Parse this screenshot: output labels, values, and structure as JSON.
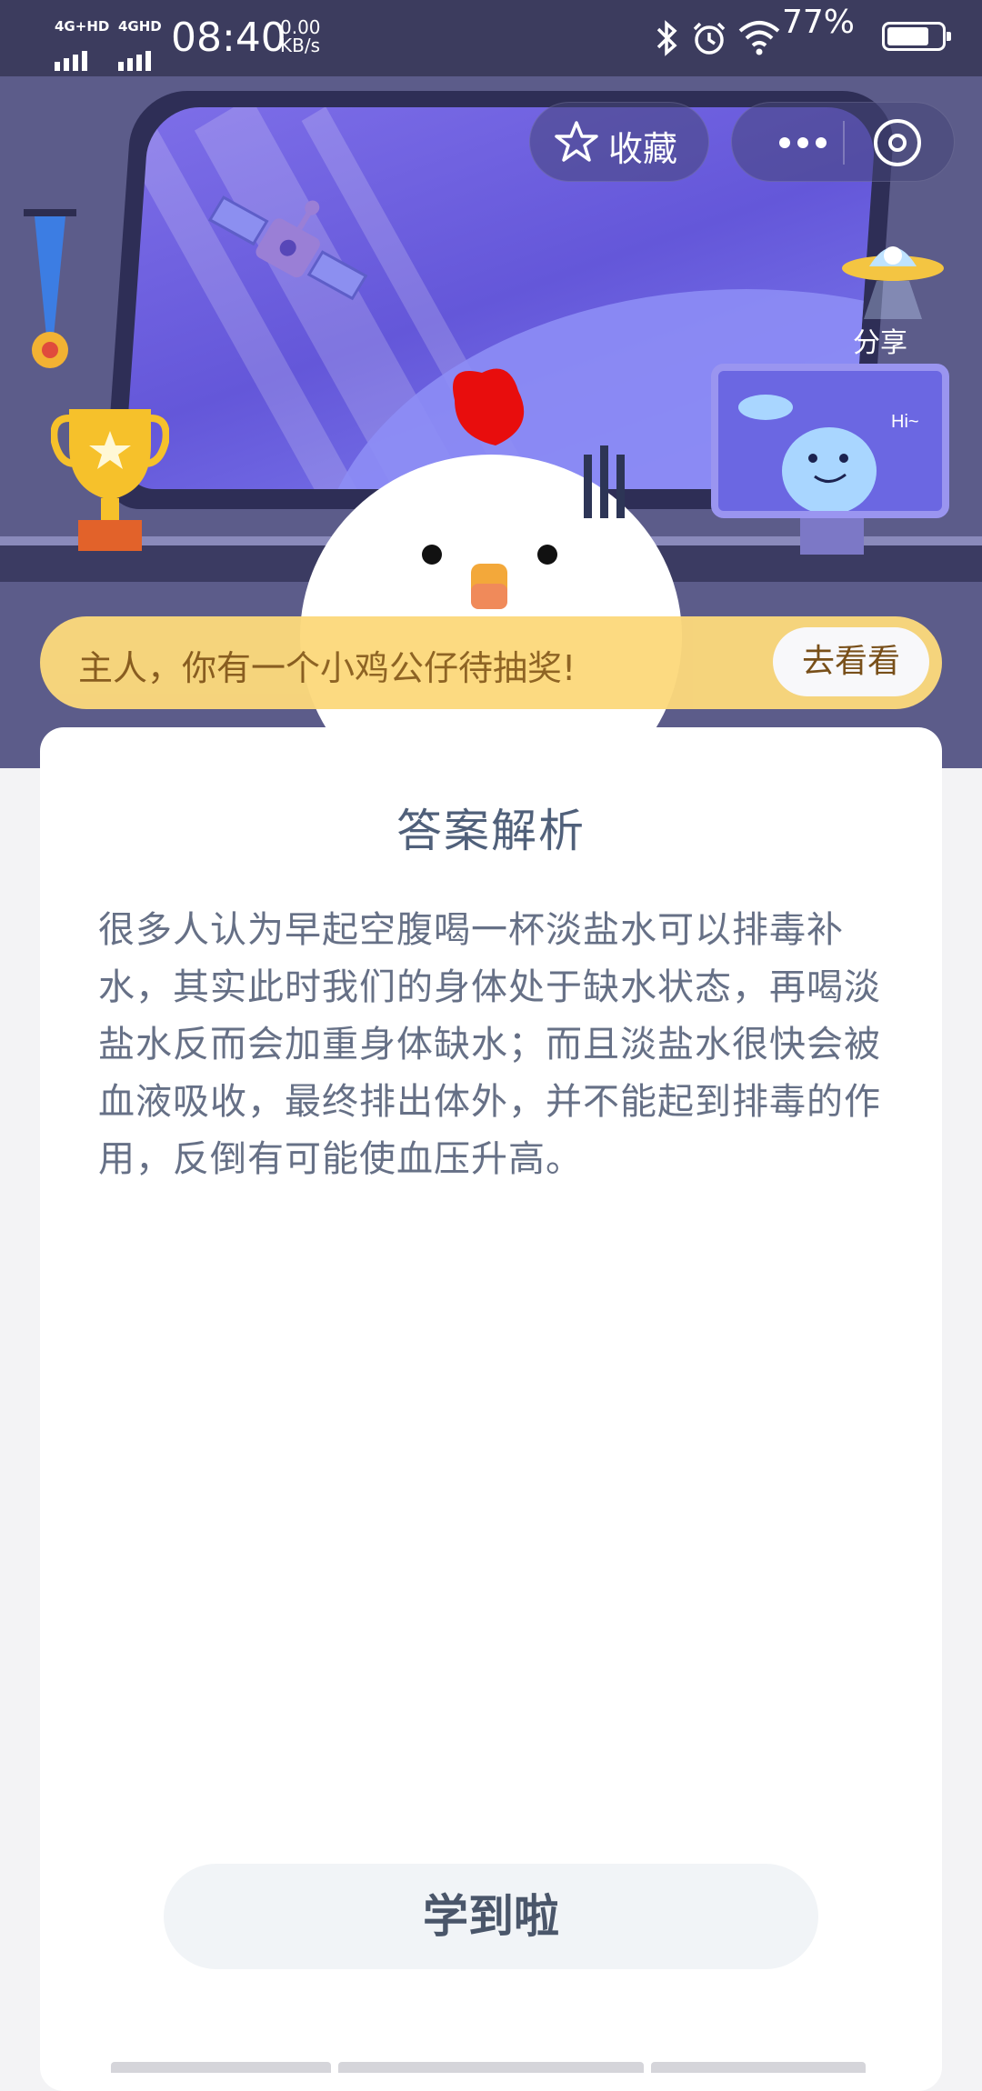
{
  "status_bar": {
    "sim1_label": "4G+HD",
    "sim2_label": "4GHD",
    "time": "08:40",
    "speed_value": "0.00",
    "speed_unit": "KB/s",
    "battery_percent": "77%",
    "battery_level": 0.77,
    "icons": [
      "bluetooth-icon",
      "alarm-icon",
      "wifi-icon",
      "battery-icon"
    ]
  },
  "header": {
    "favorite_label": "收藏",
    "share_label": "分享"
  },
  "monitor": {
    "speech": "Hi~"
  },
  "banner": {
    "text": "主人，你有一个小鸡公仔待抽奖!",
    "button_label": "去看看"
  },
  "card": {
    "title": "答案解析",
    "body": "很多人认为早起空腹喝一杯淡盐水可以排毒补水，其实此时我们的身体处于缺水状态，再喝淡盐水反而会加重身体缺水；而且淡盐水很快会被血液吸收，最终排出体外，并不能起到排毒的作用，反倒有可能使血压升高。",
    "button_label": "学到啦"
  },
  "colors": {
    "status_bar_bg": "#3c3c5e",
    "scene_bg": "#5c5c8a",
    "banner_bg": "#fcd97c",
    "title_text": "#50607a",
    "body_text": "#667086"
  }
}
